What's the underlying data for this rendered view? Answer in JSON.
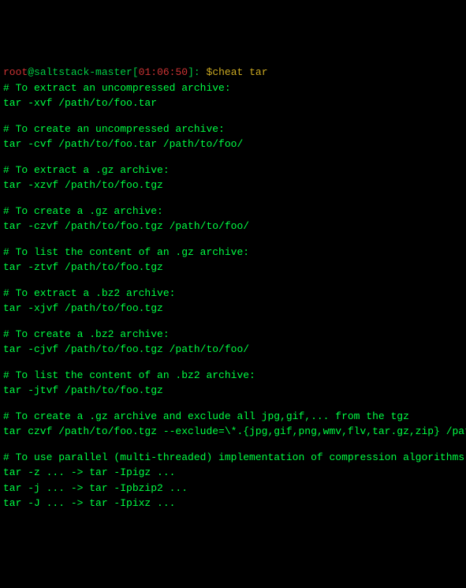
{
  "prompt": {
    "user": "root",
    "at": "@",
    "host": "saltstack-master",
    "lb": "[",
    "time": "01:06:50",
    "rb": "]",
    "tail": ": ",
    "dollar": "$",
    "command": "cheat tar"
  },
  "sections": [
    {
      "comment": "# To extract an uncompressed archive:",
      "cmd": "tar -xvf /path/to/foo.tar"
    },
    {
      "comment": "# To create an uncompressed archive:",
      "cmd": "tar -cvf /path/to/foo.tar /path/to/foo/"
    },
    {
      "comment": "# To extract a .gz archive:",
      "cmd": "tar -xzvf /path/to/foo.tgz"
    },
    {
      "comment": "# To create a .gz archive:",
      "cmd": "tar -czvf /path/to/foo.tgz /path/to/foo/"
    },
    {
      "comment": "# To list the content of an .gz archive:",
      "cmd": "tar -ztvf /path/to/foo.tgz"
    },
    {
      "comment": "# To extract a .bz2 archive:",
      "cmd": "tar -xjvf /path/to/foo.tgz"
    },
    {
      "comment": "# To create a .bz2 archive:",
      "cmd": "tar -cjvf /path/to/foo.tgz /path/to/foo/"
    },
    {
      "comment": "# To list the content of an .bz2 archive:",
      "cmd": "tar -jtvf /path/to/foo.tgz"
    },
    {
      "comment": "# To create a .gz archive and exclude all jpg,gif,... from the tgz",
      "cmd": "tar czvf /path/to/foo.tgz --exclude=\\*.{jpg,gif,png,wmv,flv,tar.gz,zip} /path/to/foo/"
    },
    {
      "comment": "# To use parallel (multi-threaded) implementation of compression algorithms:",
      "cmds": [
        "tar -z ... -> tar -Ipigz ...",
        "tar -j ... -> tar -Ipbzip2 ...",
        "tar -J ... -> tar -Ipixz ..."
      ]
    }
  ]
}
